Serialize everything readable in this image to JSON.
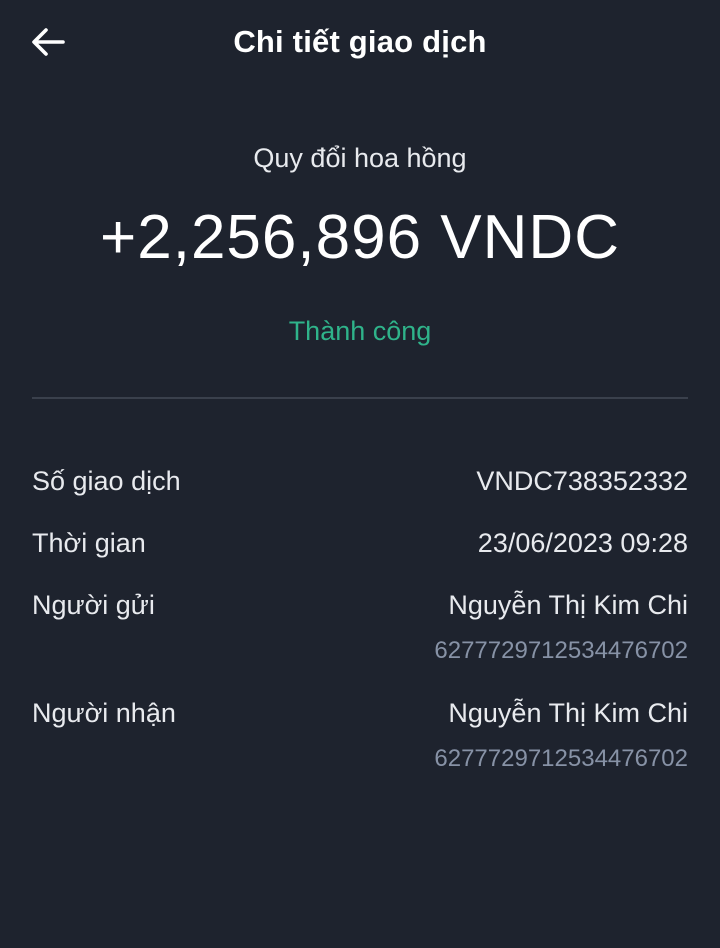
{
  "header": {
    "title": "Chi tiết giao dịch",
    "back_icon": "arrow-left-icon"
  },
  "summary": {
    "type": "Quy đổi hoa hồng",
    "amount": "+2,256,896 VNDC",
    "status": "Thành công"
  },
  "details": {
    "transaction_id": {
      "label": "Số giao dịch",
      "value": "VNDC738352332"
    },
    "time": {
      "label": "Thời gian",
      "value": "23/06/2023 09:28"
    },
    "sender": {
      "label": "Người gửi",
      "name": "Nguyễn Thị Kim Chi",
      "account": "6277729712534476702"
    },
    "receiver": {
      "label": "Người nhận",
      "name": "Nguyễn Thị Kim Chi",
      "account": "6277729712534476702"
    }
  },
  "colors": {
    "background": "#1e232e",
    "status_success": "#2fb38a",
    "secondary_text": "#8792a6",
    "divider": "#3a404c"
  }
}
